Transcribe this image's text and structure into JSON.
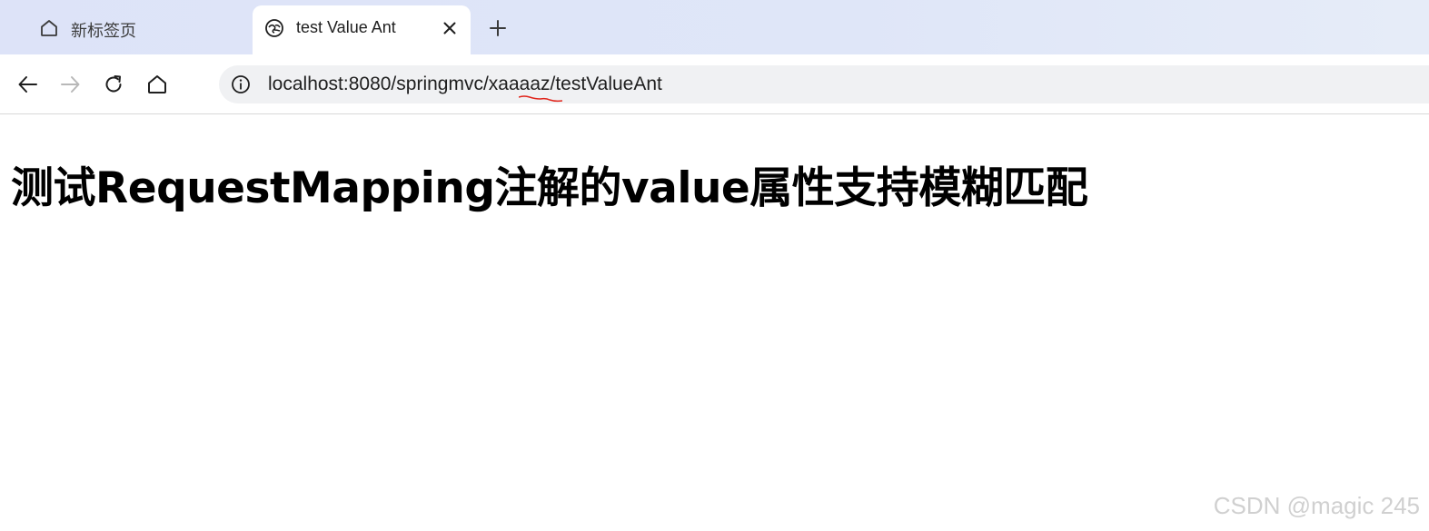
{
  "tabs": [
    {
      "label": "新标签页",
      "icon": "home-icon",
      "active": false
    },
    {
      "label": "test Value Ant",
      "icon": "page-favicon-icon",
      "active": true
    }
  ],
  "toolbar": {
    "back_icon": "arrow-left-icon",
    "forward_icon": "arrow-right-icon",
    "reload_icon": "reload-icon",
    "home_icon": "home-icon"
  },
  "omnibox": {
    "url": "localhost:8080/springmvc/xaaaaz/testValueAnt",
    "info_icon": "info-icon"
  },
  "page": {
    "heading": "测试RequestMapping注解的value属性支持模糊匹配"
  },
  "watermark": "CSDN @magic 245",
  "colors": {
    "tabstrip": "#dde3f8",
    "omnibox": "#f0f1f3",
    "annotation": "#e0241a"
  }
}
